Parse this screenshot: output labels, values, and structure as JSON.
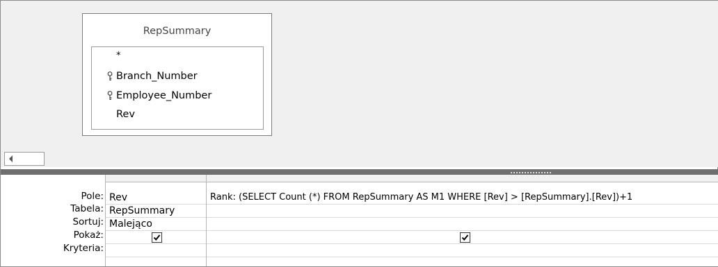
{
  "design": {
    "table_title": "RepSummary",
    "fields": [
      "*",
      "Branch_Number",
      "Employee_Number",
      "Rev"
    ],
    "key_fields": [
      "Branch_Number",
      "Employee_Number"
    ]
  },
  "grid": {
    "row_labels": {
      "field": "Pole:",
      "table": "Tabela:",
      "sort": "Sortuj:",
      "show": "Pokaż:",
      "criteria": "Kryteria:"
    },
    "columns": [
      {
        "field": "Rev",
        "table": "RepSummary",
        "sort": "Malejąco",
        "show": true,
        "criteria": ""
      },
      {
        "field": "Rank: (SELECT Count (*) FROM RepSummary AS M1 WHERE [Rev] > [RepSummary].[Rev])+1",
        "table": "",
        "sort": "",
        "show": true,
        "criteria": ""
      }
    ]
  }
}
